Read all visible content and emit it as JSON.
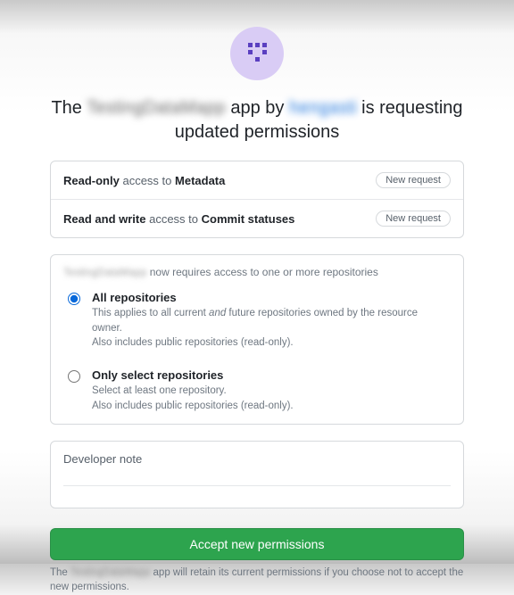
{
  "header": {
    "app_name_blurred": "TestingDataMapp",
    "by_word": "app by",
    "owner_blurred": "hengasti",
    "title_pre": "The",
    "title_suffix": "is requesting updated permissions"
  },
  "permissions": [
    {
      "prefix": "Read-only",
      "middle": "access to",
      "target": "Metadata",
      "badge": "New request"
    },
    {
      "prefix": "Read and write",
      "middle": "access to",
      "target": "Commit statuses",
      "badge": "New request"
    }
  ],
  "repo_access": {
    "intro_app_blurred": "TestingDataMapp",
    "intro_text": "now requires access to one or more repositories",
    "options": [
      {
        "id": "all",
        "selected": true,
        "title": "All repositories",
        "desc_line1_pre": "This applies to all current ",
        "desc_line1_em": "and",
        "desc_line1_post": " future repositories owned by the resource owner.",
        "desc_line2": "Also includes public repositories (read-only)."
      },
      {
        "id": "select",
        "selected": false,
        "title": "Only select repositories",
        "desc_line1": "Select at least one repository.",
        "desc_line2": "Also includes public repositories (read-only)."
      }
    ]
  },
  "developer_note": {
    "label": "Developer note"
  },
  "accept": {
    "label": "Accept new permissions"
  },
  "footnote": {
    "pre": "The",
    "app_blurred": "TestingDataMapp",
    "post": "app will retain its current permissions if you choose not to accept the new permissions."
  }
}
